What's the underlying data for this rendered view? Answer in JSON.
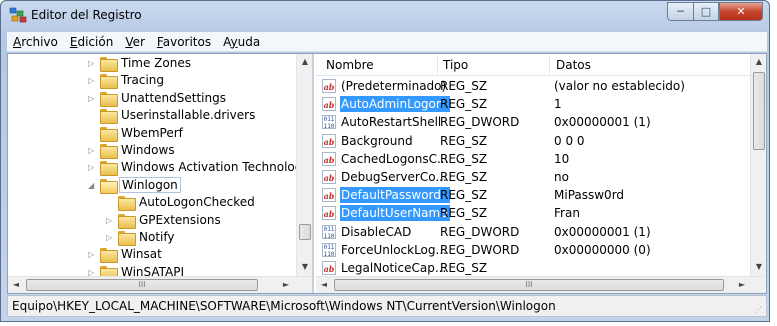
{
  "window": {
    "title": "Editor del Registro",
    "controls": {
      "minimize": "─",
      "maximize": "□",
      "close": "✕"
    }
  },
  "menu": [
    {
      "label": "Archivo",
      "accel": "A"
    },
    {
      "label": "Edición",
      "accel": "E"
    },
    {
      "label": "Ver",
      "accel": "V"
    },
    {
      "label": "Favoritos",
      "accel": "F"
    },
    {
      "label": "Ayuda",
      "accel": "y"
    }
  ],
  "tree": {
    "items": [
      {
        "label": "Time Zones",
        "expander": "▷",
        "open": false,
        "selected": false
      },
      {
        "label": "Tracing",
        "expander": "▷",
        "open": false,
        "selected": false
      },
      {
        "label": "UnattendSettings",
        "expander": "▷",
        "open": false,
        "selected": false
      },
      {
        "label": "Userinstallable.drivers",
        "expander": "",
        "open": false,
        "selected": false
      },
      {
        "label": "WbemPerf",
        "expander": "",
        "open": false,
        "selected": false
      },
      {
        "label": "Windows",
        "expander": "▷",
        "open": false,
        "selected": false
      },
      {
        "label": "Windows Activation Technologies",
        "expander": "▷",
        "open": false,
        "selected": false
      },
      {
        "label": "Winlogon",
        "expander": "◢",
        "open": true,
        "selected": true
      },
      {
        "label": "AutoLogonChecked",
        "expander": "",
        "open": false,
        "selected": false
      },
      {
        "label": "GPExtensions",
        "expander": "▷",
        "open": false,
        "selected": false
      },
      {
        "label": "Notify",
        "expander": "▷",
        "open": false,
        "selected": false
      },
      {
        "label": "Winsat",
        "expander": "▷",
        "open": false,
        "selected": false
      },
      {
        "label": "WinSATAPI",
        "expander": "▷",
        "open": false,
        "selected": false
      }
    ],
    "scroll_up": "▲",
    "scroll_down": "▼",
    "scroll_left": "◄",
    "scroll_right": "►",
    "hthumb_grip": "III"
  },
  "list": {
    "columns": {
      "name": "Nombre",
      "type": "Tipo",
      "data": "Datos"
    },
    "rows": [
      {
        "name": "(Predeterminado)",
        "type": "REG_SZ",
        "data": "(valor no establecido)",
        "icon": "reg-sz-icon",
        "highlight": false
      },
      {
        "name": "AutoAdminLogon",
        "type": "REG_SZ",
        "data": "1",
        "icon": "reg-sz-icon",
        "highlight": true
      },
      {
        "name": "AutoRestartShell",
        "type": "REG_DWORD",
        "data": "0x00000001 (1)",
        "icon": "reg-dword-icon",
        "highlight": false
      },
      {
        "name": "Background",
        "type": "REG_SZ",
        "data": "0 0 0",
        "icon": "reg-sz-icon",
        "highlight": false
      },
      {
        "name": "CachedLogonsC...",
        "type": "REG_SZ",
        "data": "10",
        "icon": "reg-sz-icon",
        "highlight": false
      },
      {
        "name": "DebugServerCo...",
        "type": "REG_SZ",
        "data": "no",
        "icon": "reg-sz-icon",
        "highlight": false
      },
      {
        "name": "DefaultPassword",
        "type": "REG_SZ",
        "data": "MiPassw0rd",
        "icon": "reg-sz-icon",
        "highlight": true
      },
      {
        "name": "DefaultUserName",
        "type": "REG_SZ",
        "data": "Fran",
        "icon": "reg-sz-icon",
        "highlight": true
      },
      {
        "name": "DisableCAD",
        "type": "REG_DWORD",
        "data": "0x00000001 (1)",
        "icon": "reg-dword-icon",
        "highlight": false
      },
      {
        "name": "ForceUnlockLog...",
        "type": "REG_DWORD",
        "data": "0x00000000 (0)",
        "icon": "reg-dword-icon",
        "highlight": false
      },
      {
        "name": "LegalNoticeCap...",
        "type": "REG_SZ",
        "data": "",
        "icon": "reg-sz-icon",
        "highlight": false
      }
    ],
    "icon_glyphs": {
      "sz": "ab",
      "dword": "011\n110"
    },
    "scroll_up": "▲",
    "scroll_down": "▼",
    "scroll_left": "◄",
    "scroll_right": "►",
    "hthumb_grip": "III"
  },
  "status": {
    "path": "Equipo\\HKEY_LOCAL_MACHINE\\SOFTWARE\\Microsoft\\Windows NT\\CurrentVersion\\Winlogon"
  },
  "colors": {
    "highlight": "#3399ff",
    "folder": "#e9bf4c",
    "title_bg": "#c3d4ea"
  }
}
